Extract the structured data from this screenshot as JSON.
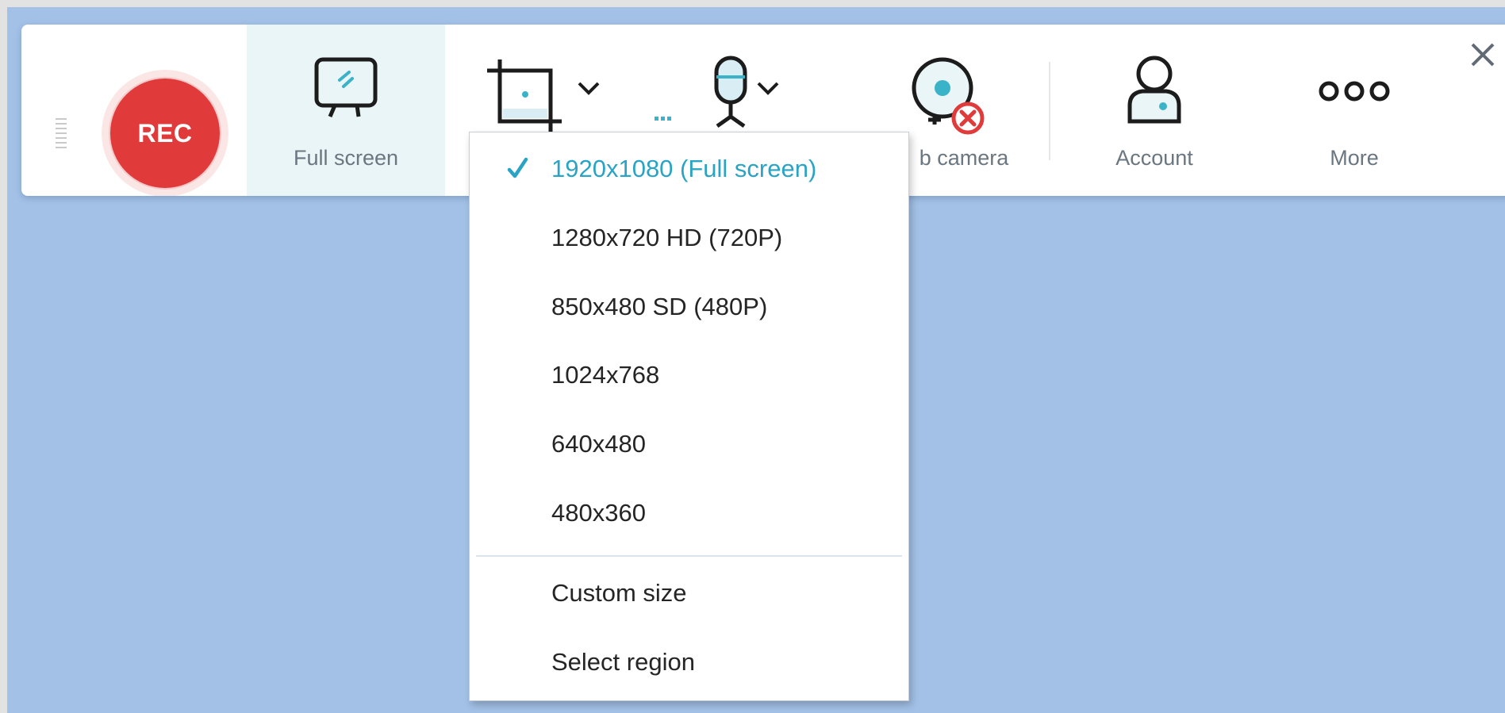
{
  "toolbar": {
    "rec_label": "REC",
    "tools": {
      "full_screen": "Full screen",
      "web_camera": "b camera",
      "account": "Account",
      "more": "More"
    }
  },
  "dropdown": {
    "items": [
      {
        "label": "1920x1080 (Full screen)",
        "selected": true
      },
      {
        "label": "1280x720 HD (720P)",
        "selected": false
      },
      {
        "label": "850x480 SD (480P)",
        "selected": false
      },
      {
        "label": "1024x768",
        "selected": false
      },
      {
        "label": "640x480",
        "selected": false
      },
      {
        "label": "480x360",
        "selected": false
      }
    ],
    "extra_items": [
      {
        "label": "Custom size"
      },
      {
        "label": "Select region"
      }
    ]
  },
  "colors": {
    "accent": "#2aa4c4",
    "rec": "#e03a3b",
    "background": "#a3c1e7",
    "webcam_error": "#e03a3b"
  },
  "icons": [
    "grip-icon",
    "monitor-icon",
    "crop-icon",
    "chevron-down-icon",
    "microphone-icon",
    "webcam-icon",
    "error-icon",
    "account-icon",
    "more-icon",
    "close-icon",
    "check-icon"
  ]
}
